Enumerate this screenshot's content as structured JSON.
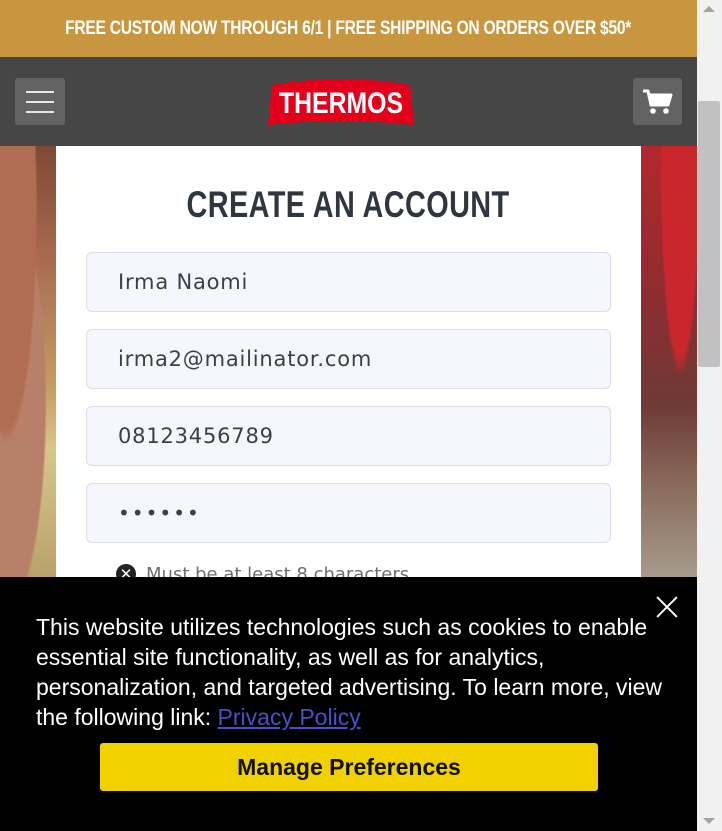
{
  "promo": {
    "text": "FREE CUSTOM NOW THROUGH 6/1 | FREE SHIPPING ON ORDERS OVER $50*"
  },
  "header": {
    "logo_text": "THERMOS",
    "menu_icon": "hamburger-menu-icon",
    "cart_icon": "shopping-cart-icon"
  },
  "form": {
    "title": "CREATE AN ACCOUNT",
    "name_value": "Irma Naomi",
    "email_value": "irma2@mailinator.com",
    "phone_value": "08123456789",
    "password_value": "••••••",
    "password_hint": "Must be at least 8 characters"
  },
  "cookie": {
    "text": "This website utilizes technologies such as cookies to enable essential site functionality, as well as for analytics, personalization, and targeted advertising. To learn more, view the following link:",
    "link_label": "Privacy Policy",
    "button_label": "Manage Preferences"
  },
  "colors": {
    "promo_bg": "#c8963f",
    "header_bg": "#464646",
    "logo_red": "#e3001b",
    "button_yellow": "#f2d100"
  }
}
